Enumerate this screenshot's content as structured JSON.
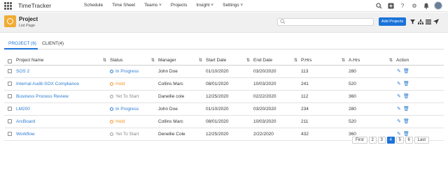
{
  "app": {
    "title": "TimeTracker"
  },
  "nav": {
    "items": [
      "Schedule",
      "Time Sheet",
      "Teams ˅",
      "Projects",
      "Insight ˅",
      "Settings ˅"
    ]
  },
  "header": {
    "title": "Project",
    "subtitle": "List Page",
    "add_button": "Add Projects",
    "search_placeholder": ""
  },
  "tabs": [
    {
      "label": "PROJECT (6)",
      "active": true
    },
    {
      "label": "CLIENT(4)",
      "active": false
    }
  ],
  "table": {
    "columns": [
      "Project Name",
      "Status",
      "Manager",
      "Start Date",
      "End Date",
      "P.Hrs",
      "A.Hrs",
      "Action"
    ],
    "rows": [
      {
        "name": "SOS 2",
        "status": "In Progress",
        "status_type": "progress",
        "manager": "John Doe",
        "start": "01/10/2020",
        "end": "03/20/2020",
        "phrs": "113",
        "ahrs": "280"
      },
      {
        "name": "Internal Audit-SOX Compliance",
        "status": "Hold",
        "status_type": "hold",
        "manager": "Collins Marc",
        "start": "08/01/2020",
        "end": "10/03/2020",
        "phrs": "241",
        "ahrs": "520"
      },
      {
        "name": "Business Process Review",
        "status": "Yet To Start",
        "status_type": "yts",
        "manager": "Danellie cole",
        "start": "12/25/2020",
        "end": "02/22/2020",
        "phrs": "112",
        "ahrs": "360"
      },
      {
        "name": "LM200",
        "status": "In Progress",
        "status_type": "progress",
        "manager": "John Doe",
        "start": "01/10/2020",
        "end": "03/20/2020",
        "phrs": "234",
        "ahrs": "280"
      },
      {
        "name": "ArcBoard",
        "status": "Hold",
        "status_type": "hold",
        "manager": "Collins Marc",
        "start": "08/01/2020",
        "end": "10/03/2020",
        "phrs": "211",
        "ahrs": "520"
      },
      {
        "name": "Workflow",
        "status": "Yet To Start",
        "status_type": "yts",
        "manager": "Denellie Cole",
        "start": "12/25/2020",
        "end": "2/22/2020",
        "phrs": "432",
        "ahrs": "360"
      }
    ]
  },
  "pagination": {
    "first": "First",
    "pages": [
      "2",
      "3",
      "4",
      "5",
      "6"
    ],
    "active": "4",
    "last": "Last"
  },
  "colors": {
    "accent": "#1a73d9",
    "hold": "#f0962c",
    "project_icon": "#f0ad35"
  }
}
